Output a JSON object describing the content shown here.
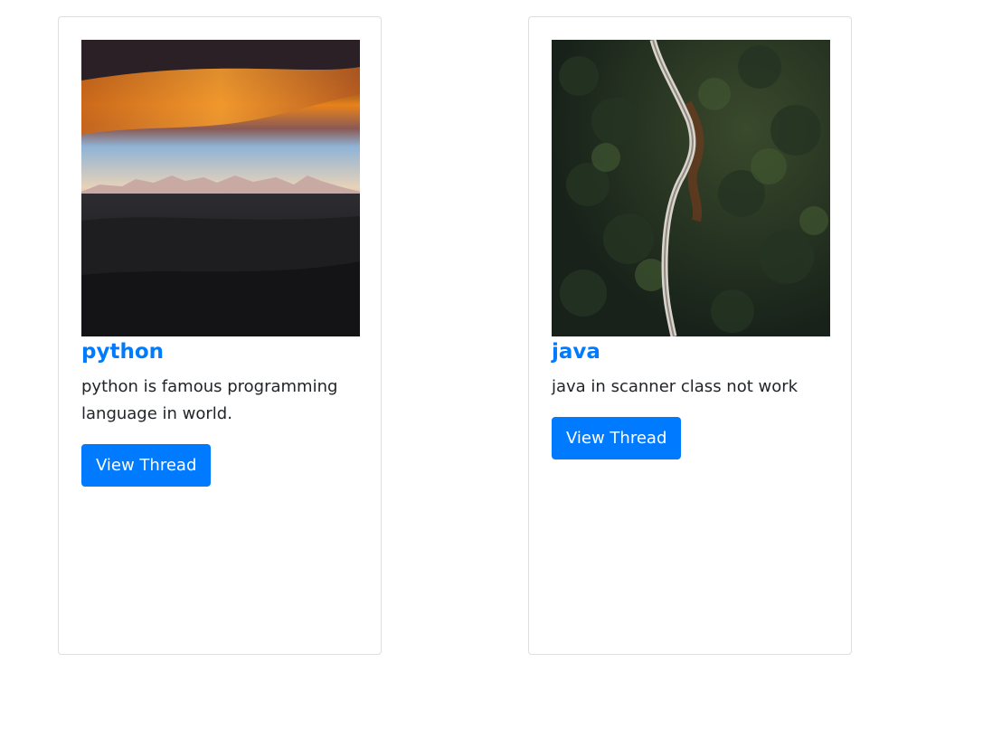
{
  "cards": [
    {
      "title": "python",
      "description": "python is famous programming language in world.",
      "button_label": "View Thread"
    },
    {
      "title": "java",
      "description": "java in scanner class not work",
      "button_label": "View Thread"
    }
  ],
  "colors": {
    "accent": "#007bff",
    "text": "#212529",
    "card_border": "#dfdfdf"
  }
}
